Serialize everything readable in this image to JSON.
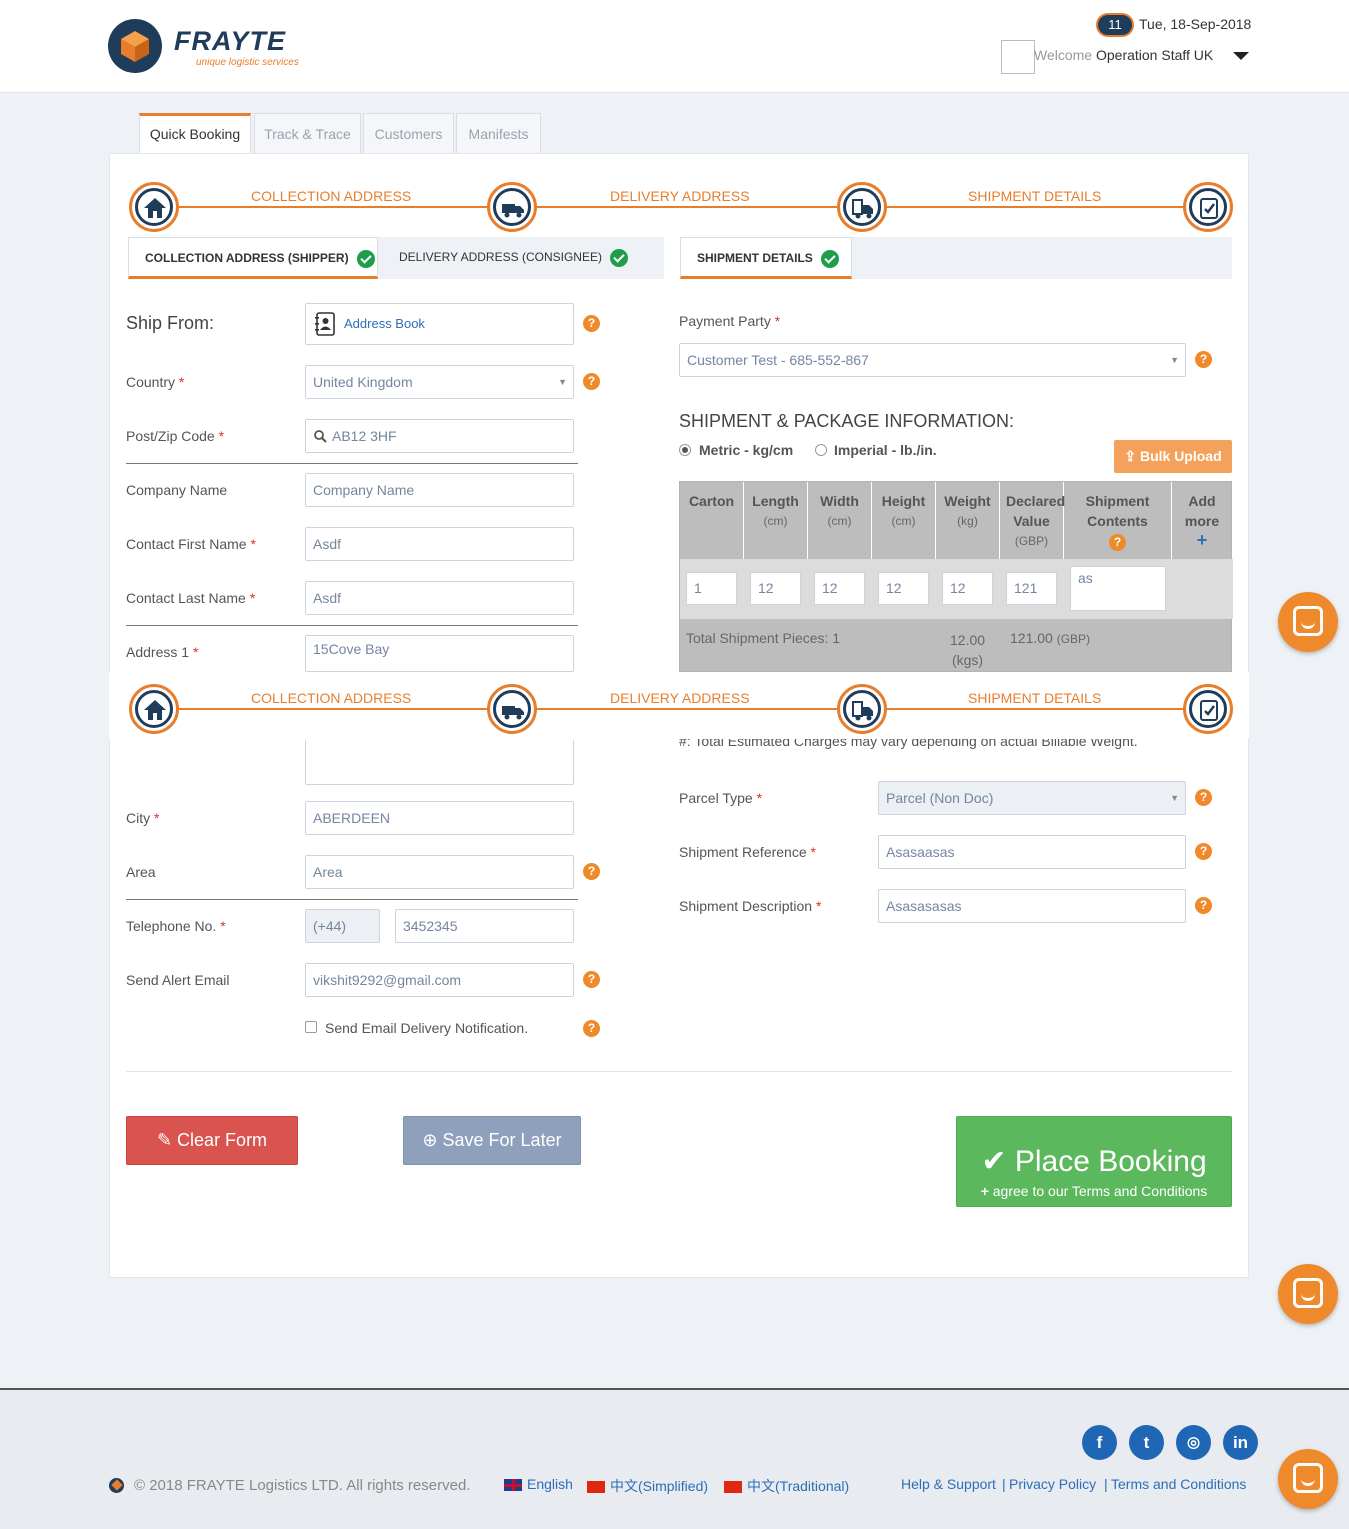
{
  "header": {
    "brand_name": "FRAYTE",
    "brand_tagline": "unique logistic services",
    "notification_count": "11",
    "date": "Tue, 18-Sep-2018",
    "welcome_label": "Welcome",
    "user_name": "Operation Staff UK"
  },
  "nav_tabs": [
    "Quick Booking",
    "Track & Trace",
    "Customers",
    "Manifests"
  ],
  "steps": [
    "COLLECTION ADDRESS",
    "DELIVERY ADDRESS",
    "SHIPMENT DETAILS"
  ],
  "sub_tabs": {
    "collection": "COLLECTION ADDRESS (SHIPPER)",
    "delivery": "DELIVERY ADDRESS (CONSIGNEE)",
    "shipment": "SHIPMENT DETAILS"
  },
  "ship_from": {
    "title": "Ship From:",
    "address_book": "Address Book",
    "country_label": "Country",
    "country_value": "United Kingdom",
    "postcode_label": "Post/Zip Code",
    "postcode_value": "AB12 3HF",
    "company_label": "Company Name",
    "company_placeholder": "Company Name",
    "first_name_label": "Contact First Name",
    "first_name_value": "Asdf",
    "last_name_label": "Contact Last Name",
    "last_name_value": "Asdf",
    "address1_label": "Address 1",
    "address1_value": "15Cove Bay",
    "city_label": "City",
    "city_value": "ABERDEEN",
    "area_label": "Area",
    "area_placeholder": "Area",
    "phone_label": "Telephone No.",
    "phone_code": "(+44)",
    "phone_value": "3452345",
    "alert_email_label": "Send Alert Email",
    "alert_email_value": "vikshit9292@gmail.com",
    "notify_label": "Send Email Delivery Notification."
  },
  "shipment": {
    "payment_party_label": "Payment Party",
    "payment_party_value": "Customer Test - 685-552-867",
    "package_info_title": "SHIPMENT & PACKAGE INFORMATION:",
    "metric_label": "Metric - kg/cm",
    "imperial_label": "Imperial - lb./in.",
    "bulk_upload": "Bulk Upload",
    "columns": [
      {
        "title": "Carton",
        "unit": ""
      },
      {
        "title": "Length",
        "unit": "(cm)"
      },
      {
        "title": "Width",
        "unit": "(cm)"
      },
      {
        "title": "Height",
        "unit": "(cm)"
      },
      {
        "title": "Weight",
        "unit": "(kg)"
      },
      {
        "title": "Declared Value",
        "unit": "(GBP)"
      },
      {
        "title": "Shipment Contents",
        "unit": ""
      },
      {
        "title": "Add more",
        "unit": ""
      }
    ],
    "row": [
      "1",
      "12",
      "12",
      "12",
      "12",
      "121",
      "as"
    ],
    "total_pieces": "Total Shipment Pieces: 1",
    "total_weight": "12.00",
    "total_weight_unit": "(kgs)",
    "total_value": "121.00",
    "total_value_unit": "(GBP)",
    "note": "#: Total Estimated Charges may vary depending on actual Billable Weight.",
    "parcel_type_label": "Parcel Type",
    "parcel_type_value": "Parcel (Non Doc)",
    "reference_label": "Shipment Reference",
    "reference_value": "Asasaasas",
    "description_label": "Shipment Description",
    "description_value": "Asasasasas"
  },
  "actions": {
    "clear": "Clear Form",
    "save": "Save For Later",
    "place": "Place Booking",
    "terms": "agree to our Terms and Conditions"
  },
  "footer": {
    "copyright": "© 2018 FRAYTE Logistics LTD. All rights reserved.",
    "lang_en": "English",
    "lang_simplified": "中文(Simplified)",
    "lang_traditional": "中文(Traditional)",
    "help": "Help & Support",
    "privacy": "Privacy Policy",
    "terms": "Terms and Conditions",
    "social": [
      "facebook-icon",
      "twitter-icon",
      "instagram-icon",
      "linkedin-icon"
    ]
  },
  "colors": {
    "accent": "#e87e2c",
    "navy": "#1f3d5a",
    "success": "#5cb85c",
    "danger": "#d9534f",
    "muted_button": "#8fa0bd"
  }
}
